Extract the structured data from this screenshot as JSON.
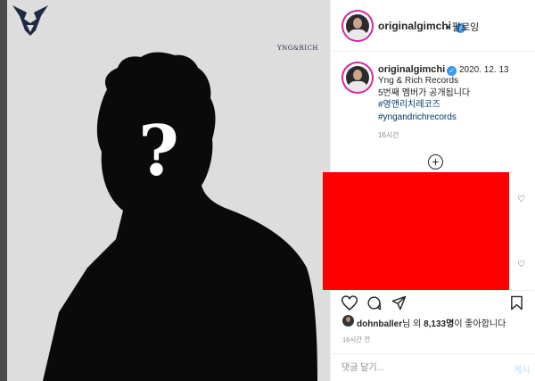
{
  "post": {
    "brand_logo_text": "YNG&RICH"
  },
  "header": {
    "username": "originalgimchi",
    "separator": "•",
    "follow_label": "팔로잉"
  },
  "caption": {
    "username": "originalgimchi",
    "date": "2020. 12. 13",
    "lines": [
      "Yng & Rich Records",
      "5번째 멤버가 공개됩니다"
    ],
    "hashtags": [
      "#영앤리치레코즈",
      "#yngandrichrecords"
    ],
    "time": "16시간"
  },
  "likes": {
    "liker": "dohnballer",
    "middle": "님 외 ",
    "count": "8,133명",
    "suffix": "이 좋아합니다"
  },
  "post_time": "16시간 전",
  "comment": {
    "placeholder": "댓글 달기...",
    "post_label": "게시"
  },
  "colors": {
    "link": "#00376b",
    "verified": "#3897f0",
    "redaction": "#ff0000"
  },
  "icons": [
    "verified-badge-icon",
    "add-comment-icon",
    "heart-icon",
    "comment-icon",
    "share-icon",
    "bookmark-icon"
  ]
}
